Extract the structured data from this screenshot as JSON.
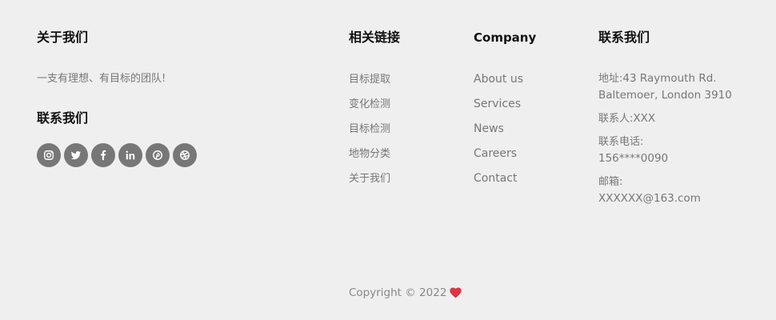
{
  "about": {
    "heading": "关于我们",
    "text": "一支有理想、有目标的团队!",
    "contact_heading": "联系我们",
    "social_icons": [
      "instagram-icon",
      "twitter-icon",
      "facebook-icon",
      "linkedin-icon",
      "pinterest-icon",
      "dribbble-icon"
    ]
  },
  "links": {
    "heading": "相关链接",
    "items": [
      "目标提取",
      "变化检测",
      "目标检测",
      "地物分类",
      "关于我们"
    ]
  },
  "company": {
    "heading": "Company",
    "items": [
      "About us",
      "Services",
      "News",
      "Careers",
      "Contact"
    ]
  },
  "contact": {
    "heading": "联系我们",
    "address_label": "地址:",
    "address_line1": "43 Raymouth Rd.",
    "address_line2": "Baltemoer, London 3910",
    "person_label": "联系人:",
    "person": "XXX",
    "phone_label": "联系电话:",
    "phone": "156****0090",
    "email_label": "邮箱:",
    "email": "XXXXXX@163.com"
  },
  "footer": {
    "copyright": "Copyright © 2022"
  },
  "colors": {
    "background": "#efefef",
    "icon_bg": "#777777",
    "heart": "#dc3545"
  }
}
